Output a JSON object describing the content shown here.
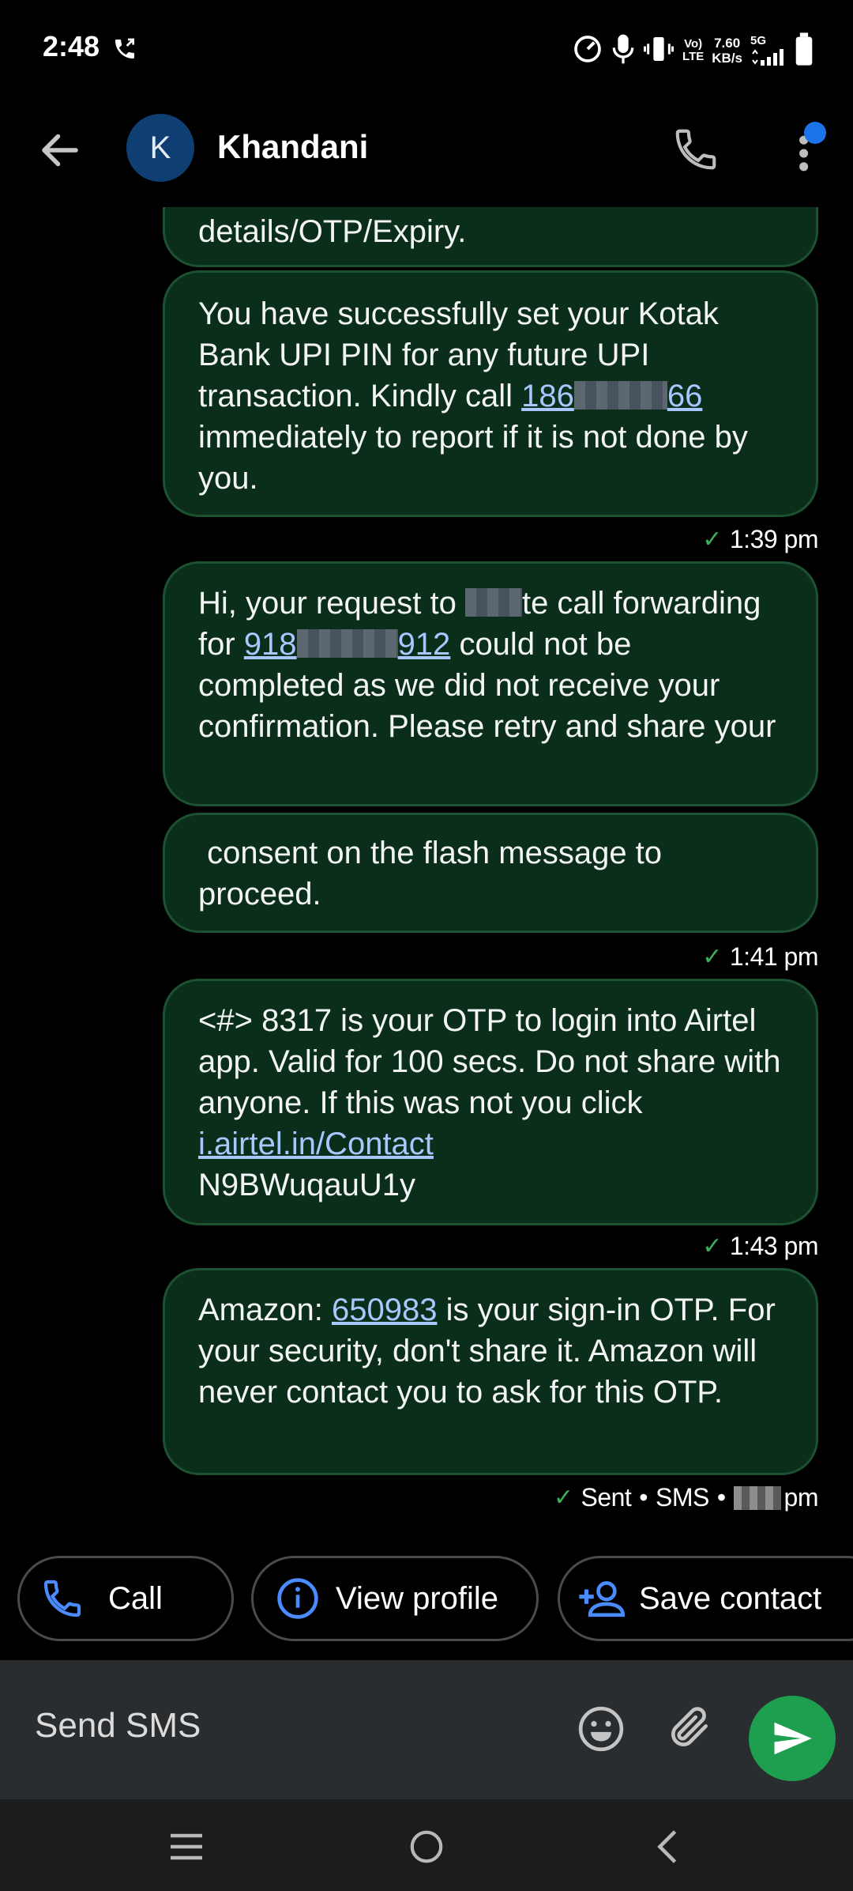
{
  "status_bar": {
    "time": "2:48",
    "network_top": "Vo)",
    "network_bottom": "LTE",
    "speed_value": "7.60",
    "speed_unit": "KB/s",
    "signal_type": "5G"
  },
  "header": {
    "avatar_letter": "K",
    "contact_name": "Khandani",
    "icons": [
      "back-arrow-icon",
      "phone-icon",
      "more-vert-icon"
    ],
    "accent_color": "#1a73e8"
  },
  "messages": [
    {
      "partial_text": "details/OTP/Expiry."
    },
    {
      "text_1": "You have successfully set your Kotak Bank UPI PIN for any future UPI transaction. Kindly call",
      "link_start": "186",
      "link_end": "66",
      "text_2": "immediately to report if it is not done by you.",
      "time": "1:39 pm"
    },
    {
      "text_1": "Hi, your request to",
      "text_1b": "te call forwarding for",
      "link_start": "918",
      "link_end": "912",
      "text_2": "could not be completed as we did not receive your confirmation. Please retry and share your"
    },
    {
      "text": " consent on the flash message to proceed.",
      "time": "1:41 pm"
    },
    {
      "text_1": "<#> 8317 is your OTP to login into Airtel app. Valid for 100 secs. Do not share with anyone. If this was not you click",
      "link": "i.airtel.in/Contact",
      "text_2": "N9BWuqauU1y",
      "time": "1:43 pm"
    },
    {
      "prefix": "Amazon:",
      "otp_link": "650983",
      "text": "is your sign-in OTP. For your security, don't share it. Amazon will never contact you to ask for this OTP.",
      "status_sent": "Sent",
      "status_sms": "SMS",
      "time_suffix": "pm"
    }
  ],
  "actions": {
    "call": "Call",
    "view_profile": "View profile",
    "save_contact": "Save contact"
  },
  "compose": {
    "placeholder": "Send SMS"
  },
  "colors": {
    "bubble_bg": "#0b2e1b",
    "bubble_border": "#1c5232",
    "link": "#a9c7ff",
    "send_button": "#1e9e4f",
    "chip_icon": "#4a8cff"
  }
}
